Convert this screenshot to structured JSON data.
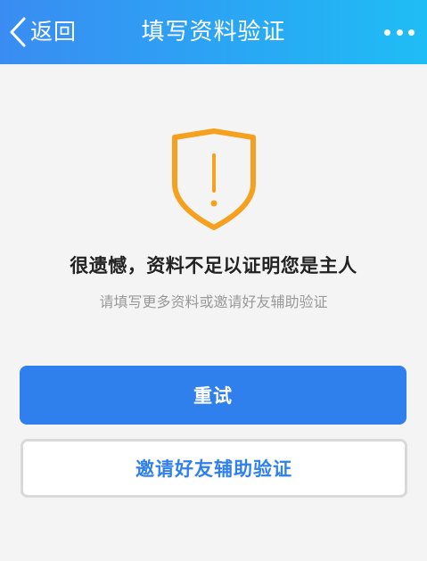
{
  "header": {
    "back_label": "返回",
    "title": "填写资料验证",
    "back_icon": "chevron-left-icon",
    "more_icon": "more-dots-icon"
  },
  "result": {
    "icon": "shield-warning-icon",
    "headline": "很遗憾，资料不足以证明您是主人",
    "subline": "请填写更多资料或邀请好友辅助验证"
  },
  "actions": {
    "retry_label": "重试",
    "invite_label": "邀请好友辅助验证"
  },
  "colors": {
    "header_gradient_start": "#3a8cf2",
    "header_gradient_end": "#1fbdf5",
    "primary": "#2f80ec",
    "warning": "#f5a01f",
    "background": "#f4f4f4"
  }
}
